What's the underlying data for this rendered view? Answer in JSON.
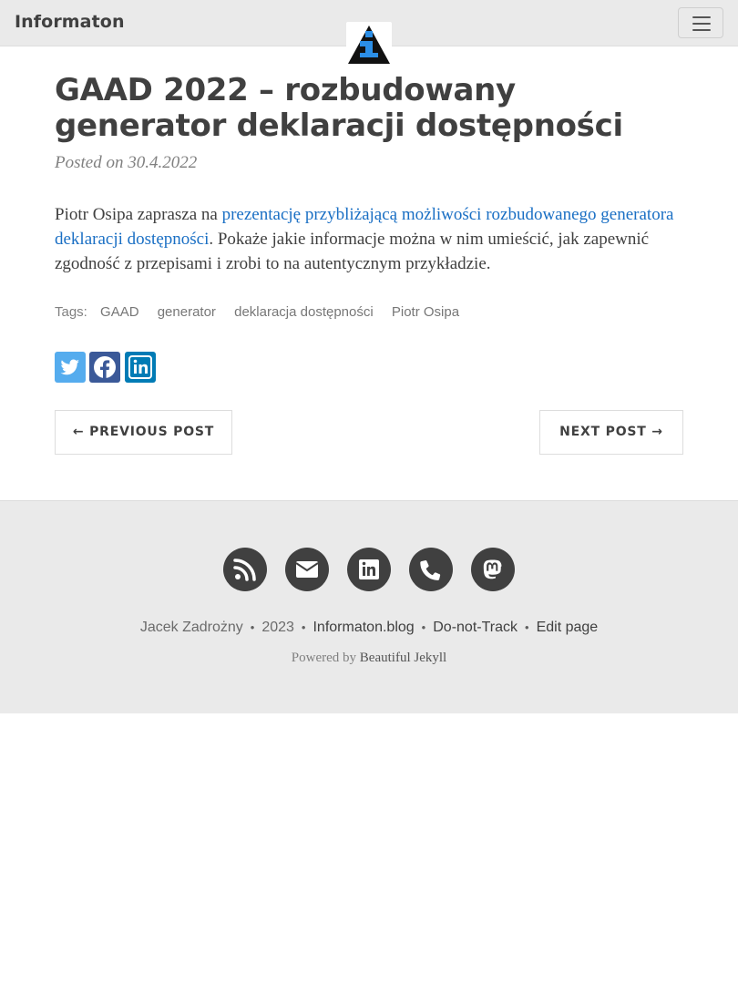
{
  "navbar": {
    "brand": "Informaton"
  },
  "post": {
    "title": "GAAD 2022 – rozbudowany generator deklaracji dostępności",
    "meta": "Posted on 30.4.2022",
    "body_prefix": "Piotr Osipa zaprasza na ",
    "body_link": "prezentację przybliżającą możliwości rozbudowanego generatora deklaracji dostępności",
    "body_suffix": ". Pokaże jakie informacje można w nim umieścić, jak zapewnić zgodność z przepisami i zrobi to na autentycznym przykładzie.",
    "tags_label": "Tags:",
    "tags": [
      "GAAD",
      "generator",
      "deklaracja dostępności",
      "Piotr Osipa"
    ]
  },
  "share": [
    {
      "icon": "twitter-icon",
      "color": "#55acee"
    },
    {
      "icon": "facebook-icon",
      "color": "#3b5998"
    },
    {
      "icon": "linkedin-icon",
      "color": "#007bb5"
    }
  ],
  "pager": {
    "previous": "← Previous Post",
    "next": "Next Post →"
  },
  "footer": {
    "social_icons": [
      "rss-icon",
      "envelope-icon",
      "linkedin-icon",
      "phone-icon",
      "mastodon-icon"
    ],
    "author": "Jacek Zadrożny",
    "year": "2023",
    "site": "Informaton.blog",
    "dnt": "Do-not-Track",
    "edit": "Edit page",
    "separator": "•",
    "powered_prefix": "Powered by ",
    "powered_link": "Beautiful Jekyll"
  },
  "colors": {
    "navbar_bg": "#eaeaea",
    "text": "#404040",
    "link": "#1a6fc4",
    "footer_bg": "#eaeaea",
    "social_circle": "#404040"
  }
}
